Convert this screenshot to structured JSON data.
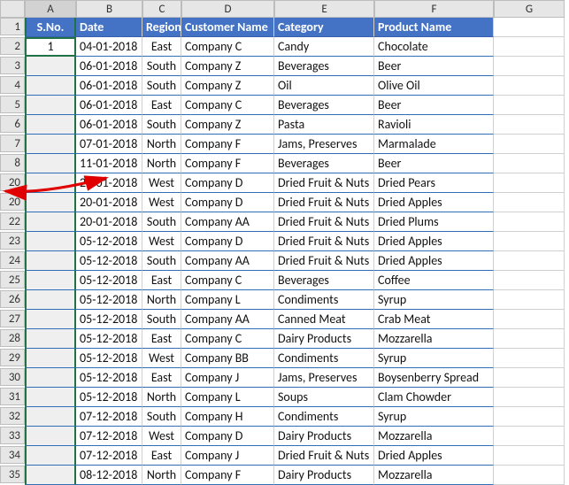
{
  "columns": [
    "A",
    "B",
    "C",
    "D",
    "E",
    "F",
    "G"
  ],
  "header": {
    "A": "S.No.",
    "B": "Date",
    "C": "Region",
    "D": "Customer Name",
    "E": "Category",
    "F": "Product Name"
  },
  "first_value": "1",
  "row_numbers_before_hidden": [
    1,
    2,
    3,
    4,
    5,
    6,
    7,
    8
  ],
  "row_numbers_after_hidden": [
    20,
    20,
    22,
    23,
    24,
    25,
    26,
    27,
    28,
    29,
    30,
    31,
    32,
    33,
    34,
    35
  ],
  "rows": [
    {
      "date": "04-01-2018",
      "region": "East",
      "customer": "Company C",
      "category": "Candy",
      "product": "Chocolate"
    },
    {
      "date": "06-01-2018",
      "region": "South",
      "customer": "Company Z",
      "category": "Beverages",
      "product": "Beer"
    },
    {
      "date": "06-01-2018",
      "region": "South",
      "customer": "Company Z",
      "category": "Oil",
      "product": "Olive Oil"
    },
    {
      "date": "06-01-2018",
      "region": "East",
      "customer": "Company C",
      "category": "Beverages",
      "product": "Beer"
    },
    {
      "date": "06-01-2018",
      "region": "South",
      "customer": "Company Z",
      "category": "Pasta",
      "product": "Ravioli"
    },
    {
      "date": "07-01-2018",
      "region": "North",
      "customer": "Company F",
      "category": "Jams, Preserves",
      "product": "Marmalade"
    },
    {
      "date": "11-01-2018",
      "region": "North",
      "customer": "Company F",
      "category": "Beverages",
      "product": "Beer"
    },
    {
      "date": "20-01-2018",
      "region": "West",
      "customer": "Company D",
      "category": "Dried Fruit & Nuts",
      "product": "Dried Pears"
    },
    {
      "date": "20-01-2018",
      "region": "West",
      "customer": "Company D",
      "category": "Dried Fruit & Nuts",
      "product": "Dried Apples"
    },
    {
      "date": "20-01-2018",
      "region": "South",
      "customer": "Company AA",
      "category": "Dried Fruit & Nuts",
      "product": "Dried Plums"
    },
    {
      "date": "05-12-2018",
      "region": "West",
      "customer": "Company D",
      "category": "Dried Fruit & Nuts",
      "product": "Dried Apples"
    },
    {
      "date": "05-12-2018",
      "region": "South",
      "customer": "Company AA",
      "category": "Dried Fruit & Nuts",
      "product": "Dried Apples"
    },
    {
      "date": "05-12-2018",
      "region": "East",
      "customer": "Company C",
      "category": "Beverages",
      "product": "Coffee"
    },
    {
      "date": "05-12-2018",
      "region": "North",
      "customer": "Company L",
      "category": "Condiments",
      "product": "Syrup"
    },
    {
      "date": "05-12-2018",
      "region": "South",
      "customer": "Company AA",
      "category": "Canned Meat",
      "product": "Crab Meat"
    },
    {
      "date": "05-12-2018",
      "region": "East",
      "customer": "Company C",
      "category": "Dairy Products",
      "product": "Mozzarella"
    },
    {
      "date": "05-12-2018",
      "region": "West",
      "customer": "Company BB",
      "category": "Condiments",
      "product": "Syrup"
    },
    {
      "date": "05-12-2018",
      "region": "East",
      "customer": "Company J",
      "category": "Jams, Preserves",
      "product": "Boysenberry Spread"
    },
    {
      "date": "05-12-2018",
      "region": "North",
      "customer": "Company L",
      "category": "Soups",
      "product": "Clam Chowder"
    },
    {
      "date": "07-12-2018",
      "region": "South",
      "customer": "Company H",
      "category": "Condiments",
      "product": "Syrup"
    },
    {
      "date": "07-12-2018",
      "region": "West",
      "customer": "Company D",
      "category": "Dairy Products",
      "product": "Mozzarella"
    },
    {
      "date": "07-12-2018",
      "region": "East",
      "customer": "Company J",
      "category": "Dried Fruit & Nuts",
      "product": "Dried Apples"
    },
    {
      "date": "08-12-2018",
      "region": "North",
      "customer": "Company F",
      "category": "Dairy Products",
      "product": "Mozzarella"
    }
  ]
}
